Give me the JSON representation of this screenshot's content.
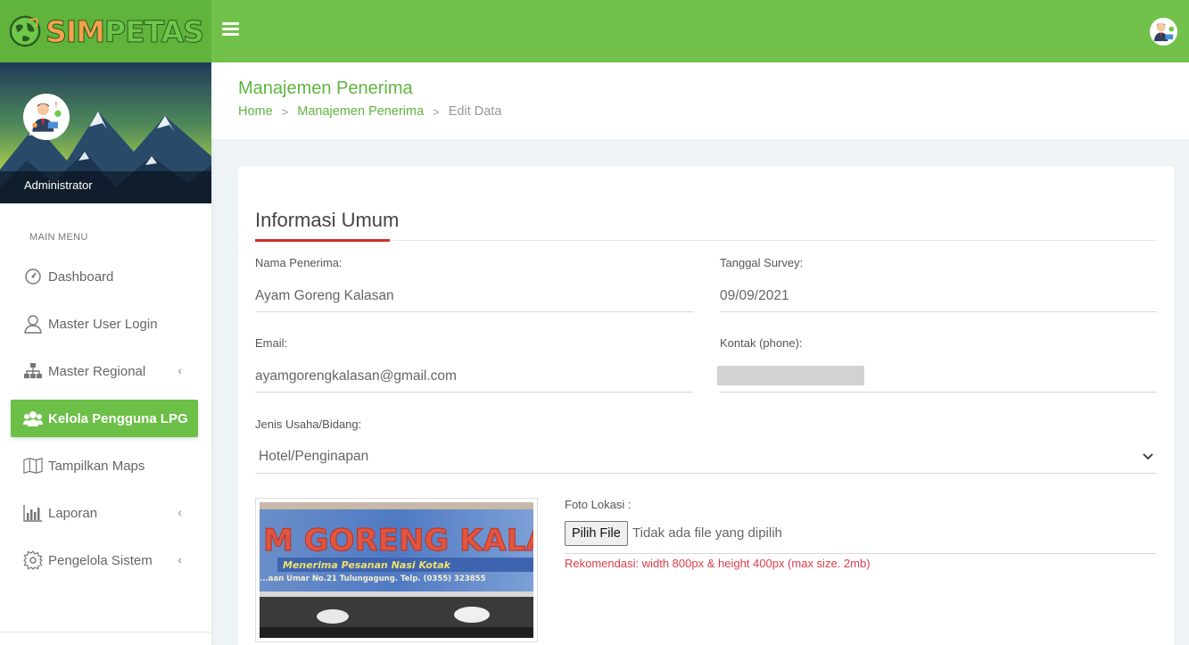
{
  "app": {
    "logo_sim": "SIM",
    "logo_petas": "PETAS",
    "brand_color": "#71c14a",
    "accent_red": "#d22c2c"
  },
  "topbar": {
    "menu_toggle_icon": "hamburger-icon",
    "user_avatar_icon": "user-avatar-icon"
  },
  "sidebar": {
    "profile_name": "Administrator",
    "menu_header": "MAIN MENU",
    "items": [
      {
        "label": "Dashboard",
        "icon": "dashboard-gauge-icon",
        "has_arrow": false,
        "active": false
      },
      {
        "label": "Master User Login",
        "icon": "user-icon",
        "has_arrow": false,
        "active": false
      },
      {
        "label": "Master Regional",
        "icon": "sitemap-icon",
        "has_arrow": true,
        "active": false
      },
      {
        "label": "Kelola Pengguna LPG",
        "icon": "users-group-icon",
        "has_arrow": false,
        "active": true
      },
      {
        "label": "Tampilkan Maps",
        "icon": "map-icon",
        "has_arrow": false,
        "active": false
      },
      {
        "label": "Laporan",
        "icon": "bar-chart-icon",
        "has_arrow": true,
        "active": false
      },
      {
        "label": "Pengelola Sistem",
        "icon": "gear-icon",
        "has_arrow": true,
        "active": false
      }
    ],
    "arrow_glyph": "‹"
  },
  "header": {
    "title": "Manajemen Penerima",
    "breadcrumb": [
      "Home",
      "Manajemen Penerima",
      "Edit Data"
    ],
    "separator": ">"
  },
  "form": {
    "section_title": "Informasi Umum",
    "nama_label": "Nama Penerima:",
    "nama_value": "Ayam Goreng Kalasan",
    "tanggal_label": "Tanggal Survey:",
    "tanggal_value": "09/09/2021",
    "email_label": "Email:",
    "email_value": "ayamgorengkalasan@gmail.com",
    "kontak_label": "Kontak (phone):",
    "jenis_label": "Jenis Usaha/Bidang:",
    "jenis_value": "Hotel/Penginapan",
    "foto_label": "Foto Lokasi :",
    "file_button": "Pilih File",
    "file_status": "Tidak ada file yang dipilih",
    "reco_prefix": "Rekomendasi:",
    "reco_text": " width 800px & height 400px (max size. 2mb)"
  },
  "photo": {
    "sign_text": "M GORENG KALAS",
    "sign_subtext": "Menerima Pesanan Nasi Kotak",
    "sign_address": "...aan Umar No.21 Tulungagung. Telp. (0355) 323855"
  }
}
